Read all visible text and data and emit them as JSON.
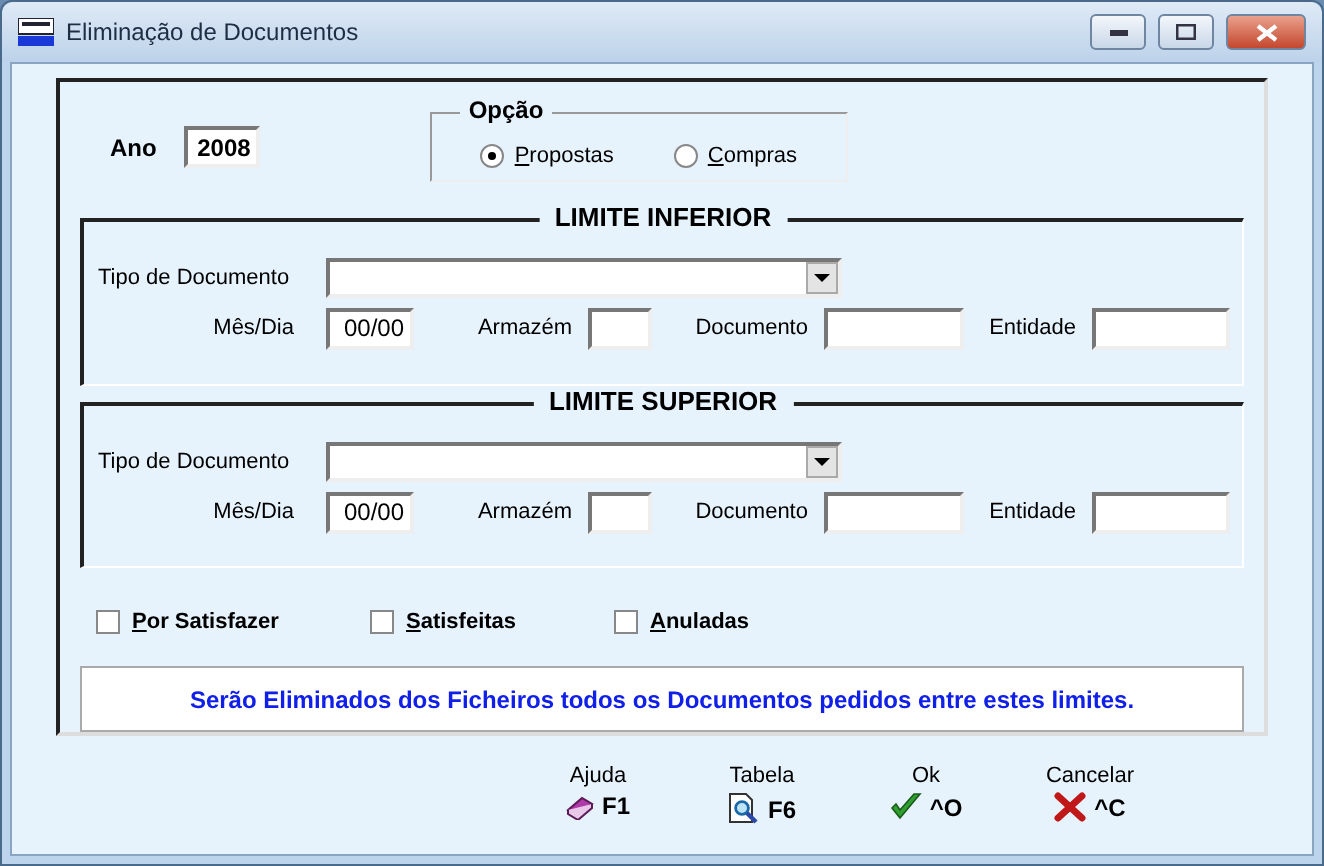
{
  "window": {
    "title": "Eliminação de Documentos"
  },
  "ano": {
    "label": "Ano",
    "value": "2008"
  },
  "opcao": {
    "title": "Opção",
    "options": [
      {
        "label": "Propostas",
        "selected": true
      },
      {
        "label": "Compras",
        "selected": false
      }
    ]
  },
  "limits": [
    {
      "title": "LIMITE INFERIOR",
      "tipo_label": "Tipo de Documento",
      "fields": [
        {
          "label": "Mês/Dia",
          "value": "00/00"
        },
        {
          "label": "Armazém"
        },
        {
          "label": "Documento"
        },
        {
          "label": "Entidade"
        }
      ]
    },
    {
      "title": "LIMITE SUPERIOR",
      "tipo_label": "Tipo de Documento",
      "fields": [
        {
          "label": "Mês/Dia",
          "value": "00/00"
        },
        {
          "label": "Armazém"
        },
        {
          "label": "Documento"
        },
        {
          "label": "Entidade"
        }
      ]
    }
  ],
  "checkboxes": [
    {
      "label": "Por Satisfazer",
      "checked": false
    },
    {
      "label": "Satisfeitas",
      "checked": false
    },
    {
      "label": "Anuladas",
      "checked": false
    }
  ],
  "message": "Serão Eliminados dos Ficheiros todos os Documentos pedidos entre estes limites.",
  "buttons": [
    {
      "kind": "help",
      "label": "Ajuda",
      "key": "F1"
    },
    {
      "kind": "table",
      "label": "Tabela",
      "key": "F6"
    },
    {
      "kind": "ok",
      "label": "Ok",
      "key": "^O"
    },
    {
      "kind": "cancel",
      "label": "Cancelar",
      "key": "^C"
    }
  ]
}
